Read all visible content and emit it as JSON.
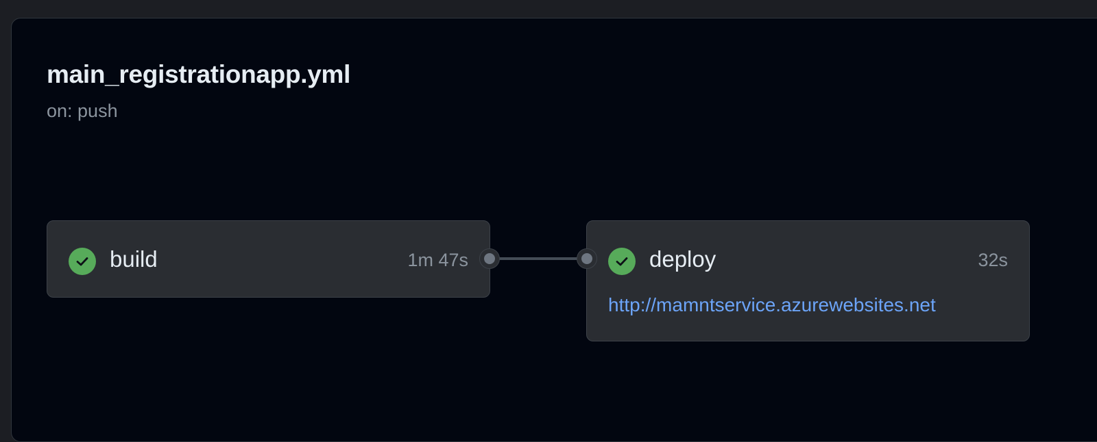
{
  "workflow": {
    "title": "main_registrationapp.yml",
    "trigger": "on: push"
  },
  "jobs": [
    {
      "name": "build",
      "duration": "1m 47s",
      "status": "success",
      "status_icon": "check-circle-icon"
    },
    {
      "name": "deploy",
      "duration": "32s",
      "status": "success",
      "status_icon": "check-circle-icon",
      "environment_url": "http://mamntservice.azurewebsites.net"
    }
  ],
  "colors": {
    "background": "#020610",
    "job_card": "#2a2d32",
    "success": "#57ab5a",
    "link": "#6ca4f8",
    "text_primary": "#e6edf3",
    "text_muted": "#8b949e"
  }
}
